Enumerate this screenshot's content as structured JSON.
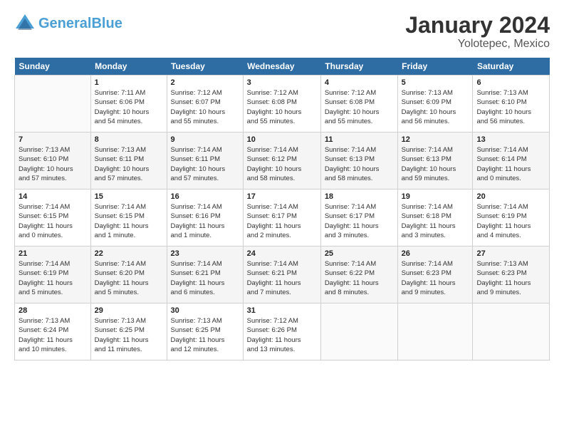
{
  "header": {
    "logo_general": "General",
    "logo_blue": "Blue",
    "title": "January 2024",
    "subtitle": "Yolotepec, Mexico"
  },
  "weekdays": [
    "Sunday",
    "Monday",
    "Tuesday",
    "Wednesday",
    "Thursday",
    "Friday",
    "Saturday"
  ],
  "weeks": [
    [
      {
        "num": "",
        "info": ""
      },
      {
        "num": "1",
        "info": "Sunrise: 7:11 AM\nSunset: 6:06 PM\nDaylight: 10 hours\nand 54 minutes."
      },
      {
        "num": "2",
        "info": "Sunrise: 7:12 AM\nSunset: 6:07 PM\nDaylight: 10 hours\nand 55 minutes."
      },
      {
        "num": "3",
        "info": "Sunrise: 7:12 AM\nSunset: 6:08 PM\nDaylight: 10 hours\nand 55 minutes."
      },
      {
        "num": "4",
        "info": "Sunrise: 7:12 AM\nSunset: 6:08 PM\nDaylight: 10 hours\nand 55 minutes."
      },
      {
        "num": "5",
        "info": "Sunrise: 7:13 AM\nSunset: 6:09 PM\nDaylight: 10 hours\nand 56 minutes."
      },
      {
        "num": "6",
        "info": "Sunrise: 7:13 AM\nSunset: 6:10 PM\nDaylight: 10 hours\nand 56 minutes."
      }
    ],
    [
      {
        "num": "7",
        "info": "Sunrise: 7:13 AM\nSunset: 6:10 PM\nDaylight: 10 hours\nand 57 minutes."
      },
      {
        "num": "8",
        "info": "Sunrise: 7:13 AM\nSunset: 6:11 PM\nDaylight: 10 hours\nand 57 minutes."
      },
      {
        "num": "9",
        "info": "Sunrise: 7:14 AM\nSunset: 6:11 PM\nDaylight: 10 hours\nand 57 minutes."
      },
      {
        "num": "10",
        "info": "Sunrise: 7:14 AM\nSunset: 6:12 PM\nDaylight: 10 hours\nand 58 minutes."
      },
      {
        "num": "11",
        "info": "Sunrise: 7:14 AM\nSunset: 6:13 PM\nDaylight: 10 hours\nand 58 minutes."
      },
      {
        "num": "12",
        "info": "Sunrise: 7:14 AM\nSunset: 6:13 PM\nDaylight: 10 hours\nand 59 minutes."
      },
      {
        "num": "13",
        "info": "Sunrise: 7:14 AM\nSunset: 6:14 PM\nDaylight: 11 hours\nand 0 minutes."
      }
    ],
    [
      {
        "num": "14",
        "info": "Sunrise: 7:14 AM\nSunset: 6:15 PM\nDaylight: 11 hours\nand 0 minutes."
      },
      {
        "num": "15",
        "info": "Sunrise: 7:14 AM\nSunset: 6:15 PM\nDaylight: 11 hours\nand 1 minute."
      },
      {
        "num": "16",
        "info": "Sunrise: 7:14 AM\nSunset: 6:16 PM\nDaylight: 11 hours\nand 1 minute."
      },
      {
        "num": "17",
        "info": "Sunrise: 7:14 AM\nSunset: 6:17 PM\nDaylight: 11 hours\nand 2 minutes."
      },
      {
        "num": "18",
        "info": "Sunrise: 7:14 AM\nSunset: 6:17 PM\nDaylight: 11 hours\nand 3 minutes."
      },
      {
        "num": "19",
        "info": "Sunrise: 7:14 AM\nSunset: 6:18 PM\nDaylight: 11 hours\nand 3 minutes."
      },
      {
        "num": "20",
        "info": "Sunrise: 7:14 AM\nSunset: 6:19 PM\nDaylight: 11 hours\nand 4 minutes."
      }
    ],
    [
      {
        "num": "21",
        "info": "Sunrise: 7:14 AM\nSunset: 6:19 PM\nDaylight: 11 hours\nand 5 minutes."
      },
      {
        "num": "22",
        "info": "Sunrise: 7:14 AM\nSunset: 6:20 PM\nDaylight: 11 hours\nand 5 minutes."
      },
      {
        "num": "23",
        "info": "Sunrise: 7:14 AM\nSunset: 6:21 PM\nDaylight: 11 hours\nand 6 minutes."
      },
      {
        "num": "24",
        "info": "Sunrise: 7:14 AM\nSunset: 6:21 PM\nDaylight: 11 hours\nand 7 minutes."
      },
      {
        "num": "25",
        "info": "Sunrise: 7:14 AM\nSunset: 6:22 PM\nDaylight: 11 hours\nand 8 minutes."
      },
      {
        "num": "26",
        "info": "Sunrise: 7:14 AM\nSunset: 6:23 PM\nDaylight: 11 hours\nand 9 minutes."
      },
      {
        "num": "27",
        "info": "Sunrise: 7:13 AM\nSunset: 6:23 PM\nDaylight: 11 hours\nand 9 minutes."
      }
    ],
    [
      {
        "num": "28",
        "info": "Sunrise: 7:13 AM\nSunset: 6:24 PM\nDaylight: 11 hours\nand 10 minutes."
      },
      {
        "num": "29",
        "info": "Sunrise: 7:13 AM\nSunset: 6:25 PM\nDaylight: 11 hours\nand 11 minutes."
      },
      {
        "num": "30",
        "info": "Sunrise: 7:13 AM\nSunset: 6:25 PM\nDaylight: 11 hours\nand 12 minutes."
      },
      {
        "num": "31",
        "info": "Sunrise: 7:12 AM\nSunset: 6:26 PM\nDaylight: 11 hours\nand 13 minutes."
      },
      {
        "num": "",
        "info": ""
      },
      {
        "num": "",
        "info": ""
      },
      {
        "num": "",
        "info": ""
      }
    ]
  ]
}
